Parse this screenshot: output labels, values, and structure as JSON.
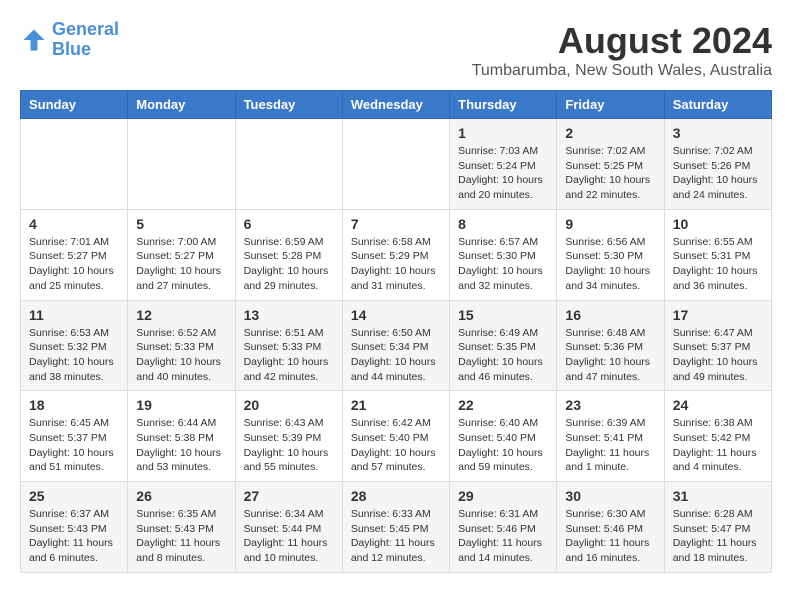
{
  "header": {
    "logo_line1": "General",
    "logo_line2": "Blue",
    "title": "August 2024",
    "subtitle": "Tumbarumba, New South Wales, Australia"
  },
  "weekdays": [
    "Sunday",
    "Monday",
    "Tuesday",
    "Wednesday",
    "Thursday",
    "Friday",
    "Saturday"
  ],
  "weeks": [
    [
      {
        "day": "",
        "info": ""
      },
      {
        "day": "",
        "info": ""
      },
      {
        "day": "",
        "info": ""
      },
      {
        "day": "",
        "info": ""
      },
      {
        "day": "1",
        "info": "Sunrise: 7:03 AM\nSunset: 5:24 PM\nDaylight: 10 hours\nand 20 minutes."
      },
      {
        "day": "2",
        "info": "Sunrise: 7:02 AM\nSunset: 5:25 PM\nDaylight: 10 hours\nand 22 minutes."
      },
      {
        "day": "3",
        "info": "Sunrise: 7:02 AM\nSunset: 5:26 PM\nDaylight: 10 hours\nand 24 minutes."
      }
    ],
    [
      {
        "day": "4",
        "info": "Sunrise: 7:01 AM\nSunset: 5:27 PM\nDaylight: 10 hours\nand 25 minutes."
      },
      {
        "day": "5",
        "info": "Sunrise: 7:00 AM\nSunset: 5:27 PM\nDaylight: 10 hours\nand 27 minutes."
      },
      {
        "day": "6",
        "info": "Sunrise: 6:59 AM\nSunset: 5:28 PM\nDaylight: 10 hours\nand 29 minutes."
      },
      {
        "day": "7",
        "info": "Sunrise: 6:58 AM\nSunset: 5:29 PM\nDaylight: 10 hours\nand 31 minutes."
      },
      {
        "day": "8",
        "info": "Sunrise: 6:57 AM\nSunset: 5:30 PM\nDaylight: 10 hours\nand 32 minutes."
      },
      {
        "day": "9",
        "info": "Sunrise: 6:56 AM\nSunset: 5:30 PM\nDaylight: 10 hours\nand 34 minutes."
      },
      {
        "day": "10",
        "info": "Sunrise: 6:55 AM\nSunset: 5:31 PM\nDaylight: 10 hours\nand 36 minutes."
      }
    ],
    [
      {
        "day": "11",
        "info": "Sunrise: 6:53 AM\nSunset: 5:32 PM\nDaylight: 10 hours\nand 38 minutes."
      },
      {
        "day": "12",
        "info": "Sunrise: 6:52 AM\nSunset: 5:33 PM\nDaylight: 10 hours\nand 40 minutes."
      },
      {
        "day": "13",
        "info": "Sunrise: 6:51 AM\nSunset: 5:33 PM\nDaylight: 10 hours\nand 42 minutes."
      },
      {
        "day": "14",
        "info": "Sunrise: 6:50 AM\nSunset: 5:34 PM\nDaylight: 10 hours\nand 44 minutes."
      },
      {
        "day": "15",
        "info": "Sunrise: 6:49 AM\nSunset: 5:35 PM\nDaylight: 10 hours\nand 46 minutes."
      },
      {
        "day": "16",
        "info": "Sunrise: 6:48 AM\nSunset: 5:36 PM\nDaylight: 10 hours\nand 47 minutes."
      },
      {
        "day": "17",
        "info": "Sunrise: 6:47 AM\nSunset: 5:37 PM\nDaylight: 10 hours\nand 49 minutes."
      }
    ],
    [
      {
        "day": "18",
        "info": "Sunrise: 6:45 AM\nSunset: 5:37 PM\nDaylight: 10 hours\nand 51 minutes."
      },
      {
        "day": "19",
        "info": "Sunrise: 6:44 AM\nSunset: 5:38 PM\nDaylight: 10 hours\nand 53 minutes."
      },
      {
        "day": "20",
        "info": "Sunrise: 6:43 AM\nSunset: 5:39 PM\nDaylight: 10 hours\nand 55 minutes."
      },
      {
        "day": "21",
        "info": "Sunrise: 6:42 AM\nSunset: 5:40 PM\nDaylight: 10 hours\nand 57 minutes."
      },
      {
        "day": "22",
        "info": "Sunrise: 6:40 AM\nSunset: 5:40 PM\nDaylight: 10 hours\nand 59 minutes."
      },
      {
        "day": "23",
        "info": "Sunrise: 6:39 AM\nSunset: 5:41 PM\nDaylight: 11 hours\nand 1 minute."
      },
      {
        "day": "24",
        "info": "Sunrise: 6:38 AM\nSunset: 5:42 PM\nDaylight: 11 hours\nand 4 minutes."
      }
    ],
    [
      {
        "day": "25",
        "info": "Sunrise: 6:37 AM\nSunset: 5:43 PM\nDaylight: 11 hours\nand 6 minutes."
      },
      {
        "day": "26",
        "info": "Sunrise: 6:35 AM\nSunset: 5:43 PM\nDaylight: 11 hours\nand 8 minutes."
      },
      {
        "day": "27",
        "info": "Sunrise: 6:34 AM\nSunset: 5:44 PM\nDaylight: 11 hours\nand 10 minutes."
      },
      {
        "day": "28",
        "info": "Sunrise: 6:33 AM\nSunset: 5:45 PM\nDaylight: 11 hours\nand 12 minutes."
      },
      {
        "day": "29",
        "info": "Sunrise: 6:31 AM\nSunset: 5:46 PM\nDaylight: 11 hours\nand 14 minutes."
      },
      {
        "day": "30",
        "info": "Sunrise: 6:30 AM\nSunset: 5:46 PM\nDaylight: 11 hours\nand 16 minutes."
      },
      {
        "day": "31",
        "info": "Sunrise: 6:28 AM\nSunset: 5:47 PM\nDaylight: 11 hours\nand 18 minutes."
      }
    ]
  ]
}
